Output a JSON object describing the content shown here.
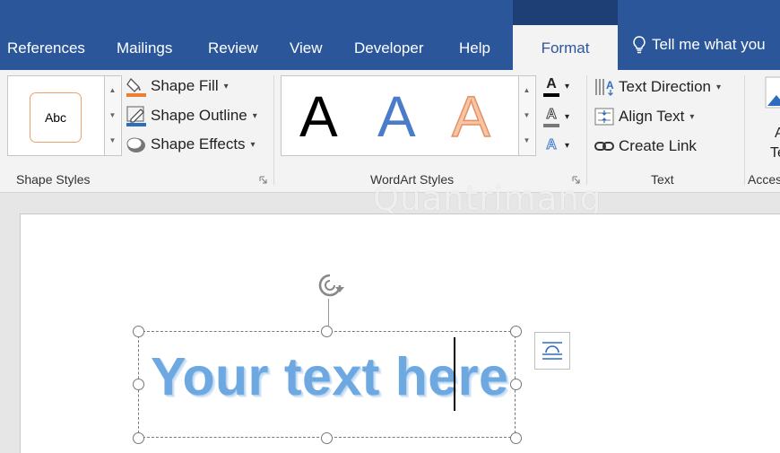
{
  "tabs": [
    {
      "label": "References"
    },
    {
      "label": "Mailings"
    },
    {
      "label": "Review"
    },
    {
      "label": "View"
    },
    {
      "label": "Developer"
    },
    {
      "label": "Help"
    },
    {
      "label": "Format",
      "active": true
    }
  ],
  "tell_me": {
    "label": "Tell me what you"
  },
  "ribbon": {
    "shape_styles": {
      "group_label": "Shape Styles",
      "thumbnail_label": "Abc",
      "commands": [
        {
          "label": "Shape Fill",
          "icon": "paint-bucket-icon"
        },
        {
          "label": "Shape Outline",
          "icon": "pen-outline-icon"
        },
        {
          "label": "Shape Effects",
          "icon": "shape-effects-icon"
        }
      ]
    },
    "wordart_styles": {
      "group_label": "WordArt Styles",
      "letters": [
        "A",
        "A",
        "A"
      ],
      "text_fill_letter": "A",
      "text_outline_letter": "A",
      "text_effects_letter": "A"
    },
    "text": {
      "group_label": "Text",
      "commands": [
        {
          "label": "Text Direction",
          "icon": "text-direction-icon"
        },
        {
          "label": "Align Text",
          "icon": "align-text-icon"
        },
        {
          "label": "Create Link",
          "icon": "link-icon"
        }
      ]
    },
    "accessibility": {
      "group_label": "Acces",
      "button_letters": [
        "A",
        "Te"
      ]
    }
  },
  "document": {
    "wordart_text": "Your text here"
  },
  "watermark": "Quantrimang",
  "colors": {
    "title_bar": "#2b579a",
    "ribbon_bg": "#f3f3f3",
    "wordart_blue": "#6ea8e0",
    "wordart_orange": "#f2b28c"
  }
}
